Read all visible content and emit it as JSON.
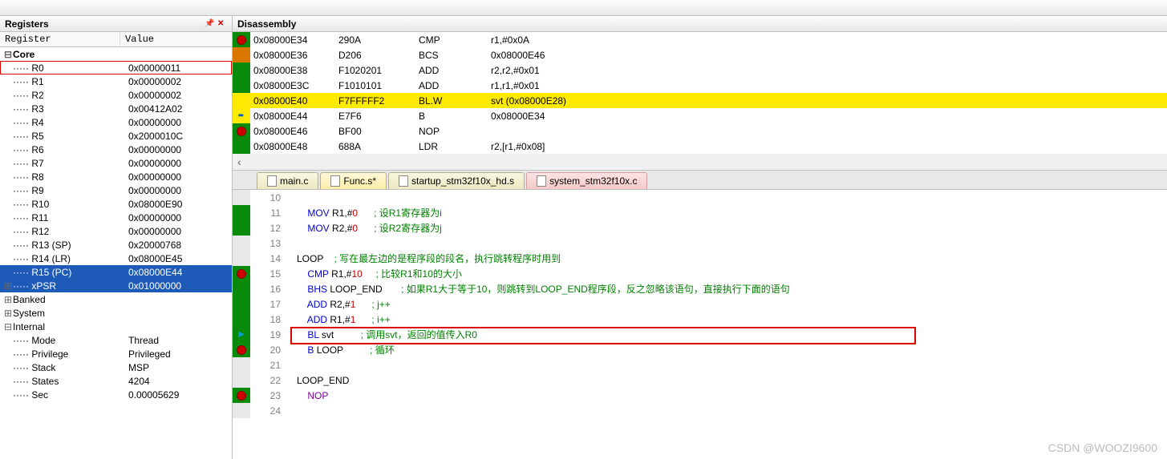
{
  "toolbar": {},
  "registers": {
    "panel_title": "Registers",
    "col_register": "Register",
    "col_value": "Value",
    "groups": {
      "core": "Core",
      "banked": "Banked",
      "system": "System",
      "internal": "Internal"
    },
    "core_regs": [
      {
        "name": "R0",
        "value": "0x00000011",
        "redbox": true
      },
      {
        "name": "R1",
        "value": "0x00000002"
      },
      {
        "name": "R2",
        "value": "0x00000002"
      },
      {
        "name": "R3",
        "value": "0x00412A02"
      },
      {
        "name": "R4",
        "value": "0x00000000"
      },
      {
        "name": "R5",
        "value": "0x2000010C"
      },
      {
        "name": "R6",
        "value": "0x00000000"
      },
      {
        "name": "R7",
        "value": "0x00000000"
      },
      {
        "name": "R8",
        "value": "0x00000000"
      },
      {
        "name": "R9",
        "value": "0x00000000"
      },
      {
        "name": "R10",
        "value": "0x08000E90"
      },
      {
        "name": "R11",
        "value": "0x00000000"
      },
      {
        "name": "R12",
        "value": "0x00000000"
      },
      {
        "name": "R13 (SP)",
        "value": "0x20000768"
      },
      {
        "name": "R14 (LR)",
        "value": "0x08000E45"
      },
      {
        "name": "R15 (PC)",
        "value": "0x08000E44",
        "selected": true
      },
      {
        "name": "xPSR",
        "value": "0x01000000",
        "selected": true,
        "expandable": true
      }
    ],
    "internal_items": [
      {
        "name": "Mode",
        "value": "Thread"
      },
      {
        "name": "Privilege",
        "value": "Privileged"
      },
      {
        "name": "Stack",
        "value": "MSP"
      },
      {
        "name": "States",
        "value": "4204"
      },
      {
        "name": "Sec",
        "value": "0.00005629"
      }
    ]
  },
  "disasm": {
    "panel_title": "Disassembly",
    "rows": [
      {
        "gutter": "green",
        "bp": true,
        "addr": "0x08000E34",
        "bytes": "290A",
        "mnem": "CMP",
        "ops": "r1,#0x0A"
      },
      {
        "gutter": "orange",
        "addr": "0x08000E36",
        "bytes": "D206",
        "mnem": "BCS",
        "ops": "0x08000E46"
      },
      {
        "gutter": "green",
        "addr": "0x08000E38",
        "bytes": "F1020201",
        "mnem": "ADD",
        "ops": "r2,r2,#0x01"
      },
      {
        "gutter": "green",
        "addr": "0x08000E3C",
        "bytes": "F1010101",
        "mnem": "ADD",
        "ops": "r1,r1,#0x01"
      },
      {
        "gutter": "yellow",
        "hl": true,
        "addr": "0x08000E40",
        "bytes": "F7FFFFF2",
        "mnem": "BL.W",
        "ops": "svt (0x08000E28)"
      },
      {
        "gutter": "yellow",
        "arrow": true,
        "addr": "0x08000E44",
        "bytes": "E7F6",
        "mnem": "B",
        "ops": "0x08000E34"
      },
      {
        "gutter": "green",
        "bp": true,
        "addr": "0x08000E46",
        "bytes": "BF00",
        "mnem": "NOP",
        "ops": ""
      },
      {
        "gutter": "green",
        "addr": "0x08000E48",
        "bytes": "688A",
        "mnem": "LDR",
        "ops": "r2,[r1,#0x08]"
      }
    ]
  },
  "tabs": [
    {
      "label": "main.c",
      "style": "normal"
    },
    {
      "label": "Func.s*",
      "style": "active"
    },
    {
      "label": "startup_stm32f10x_hd.s",
      "style": "normal"
    },
    {
      "label": "system_stm32f10x.c",
      "style": "pink"
    }
  ],
  "code": {
    "lines": [
      {
        "n": 10,
        "gutter": "",
        "html": ""
      },
      {
        "n": 11,
        "gutter": "green",
        "html": "    <span class='kw-blue'>MOV</span> R1,#<span class='num-red'>0</span>      <span class='comment'>; 设R1寄存器为i</span>"
      },
      {
        "n": 12,
        "gutter": "green",
        "html": "    <span class='kw-blue'>MOV</span> R2,#<span class='num-red'>0</span>      <span class='comment'>; 设R2寄存器为j</span>"
      },
      {
        "n": 13,
        "gutter": "",
        "html": ""
      },
      {
        "n": 14,
        "gutter": "",
        "html": "LOOP    <span class='comment'>; 写在最左边的是程序段的段名，执行跳转程序时用到</span>"
      },
      {
        "n": 15,
        "gutter": "green",
        "bp": true,
        "html": "    <span class='kw-blue'>CMP</span> R1,#<span class='num-red'>10</span>     <span class='comment'>; 比较R1和10的大小</span>"
      },
      {
        "n": 16,
        "gutter": "green",
        "html": "    <span class='kw-blue'>BHS</span> LOOP_END       <span class='comment'>; 如果R1大于等于10，则跳转到LOOP_END程序段，反之忽略该语句，直接执行下面的语句</span>"
      },
      {
        "n": 17,
        "gutter": "green",
        "html": "    <span class='kw-blue'>ADD</span> R2,#<span class='num-red'>1</span>      <span class='comment'>; j++</span>"
      },
      {
        "n": 18,
        "gutter": "green",
        "html": "    <span class='kw-blue'>ADD</span> R1,#<span class='num-red'>1</span>      <span class='comment'>; i++</span>"
      },
      {
        "n": 19,
        "gutter": "green",
        "curr": true,
        "html": "    <span class='kw-blue'>BL</span> svt          <span class='comment'>; 调用svt，返回的值传入R0</span>"
      },
      {
        "n": 20,
        "gutter": "green",
        "bp": true,
        "html": "    <span class='kw-blue'>B</span> LOOP          <span class='comment'>; 循环</span>"
      },
      {
        "n": 21,
        "gutter": "",
        "html": ""
      },
      {
        "n": 22,
        "gutter": "",
        "html": "LOOP_END"
      },
      {
        "n": 23,
        "gutter": "green",
        "bp": true,
        "html": "    <span class='kw-purple'>NOP</span>"
      },
      {
        "n": 24,
        "gutter": "",
        "html": ""
      }
    ]
  },
  "watermark": "CSDN @WOOZI9600"
}
